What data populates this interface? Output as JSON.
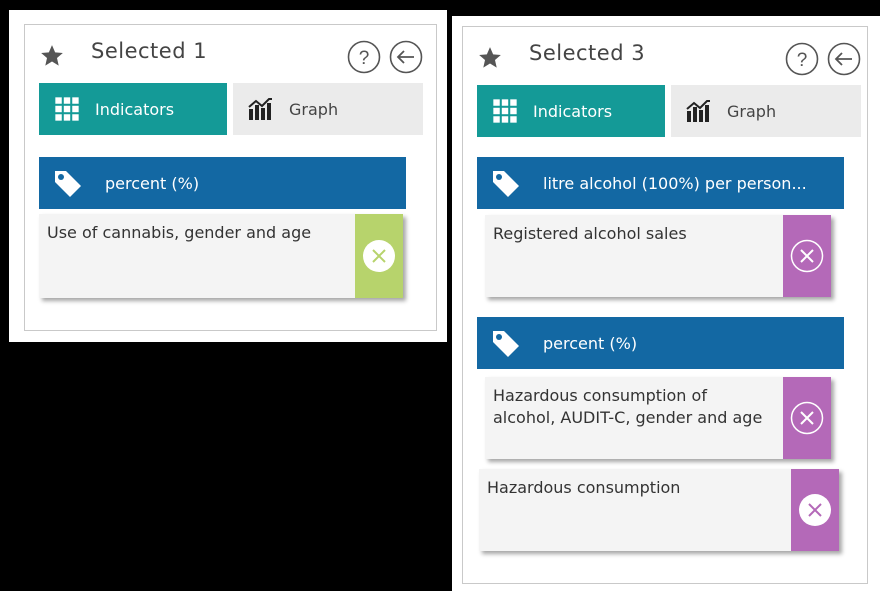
{
  "left_panel": {
    "title": "Selected 1",
    "tabs": {
      "indicators": "Indicators",
      "graph": "Graph"
    },
    "groups": [
      {
        "unit": "percent (%)",
        "items": [
          {
            "label": "Use of cannabis, gender and age",
            "remove_color": "#b7d36c"
          }
        ]
      }
    ]
  },
  "right_panel": {
    "title": "Selected 3",
    "tabs": {
      "indicators": "Indicators",
      "graph": "Graph"
    },
    "groups": [
      {
        "unit": "litre alcohol (100%) per person...",
        "items": [
          {
            "label": "Registered alcohol sales",
            "remove_color": "#b469b8"
          }
        ]
      },
      {
        "unit": "percent (%)",
        "items": [
          {
            "label": "Hazardous consumption of alcohol, AUDIT-C, gender and age",
            "remove_color": "#b469b8"
          },
          {
            "label": "Hazardous consumption",
            "remove_color": "#b469b8"
          }
        ]
      }
    ]
  },
  "colors": {
    "tab_active": "#149a97",
    "tab_inactive": "#ebebeb",
    "unit_bar": "#1368a3"
  },
  "icons": {
    "star": "star-icon",
    "help": "help-icon",
    "back": "back-arrow-icon",
    "grid": "grid-icon",
    "graph": "graph-icon",
    "tag": "tag-icon",
    "remove": "close-circle-icon"
  }
}
